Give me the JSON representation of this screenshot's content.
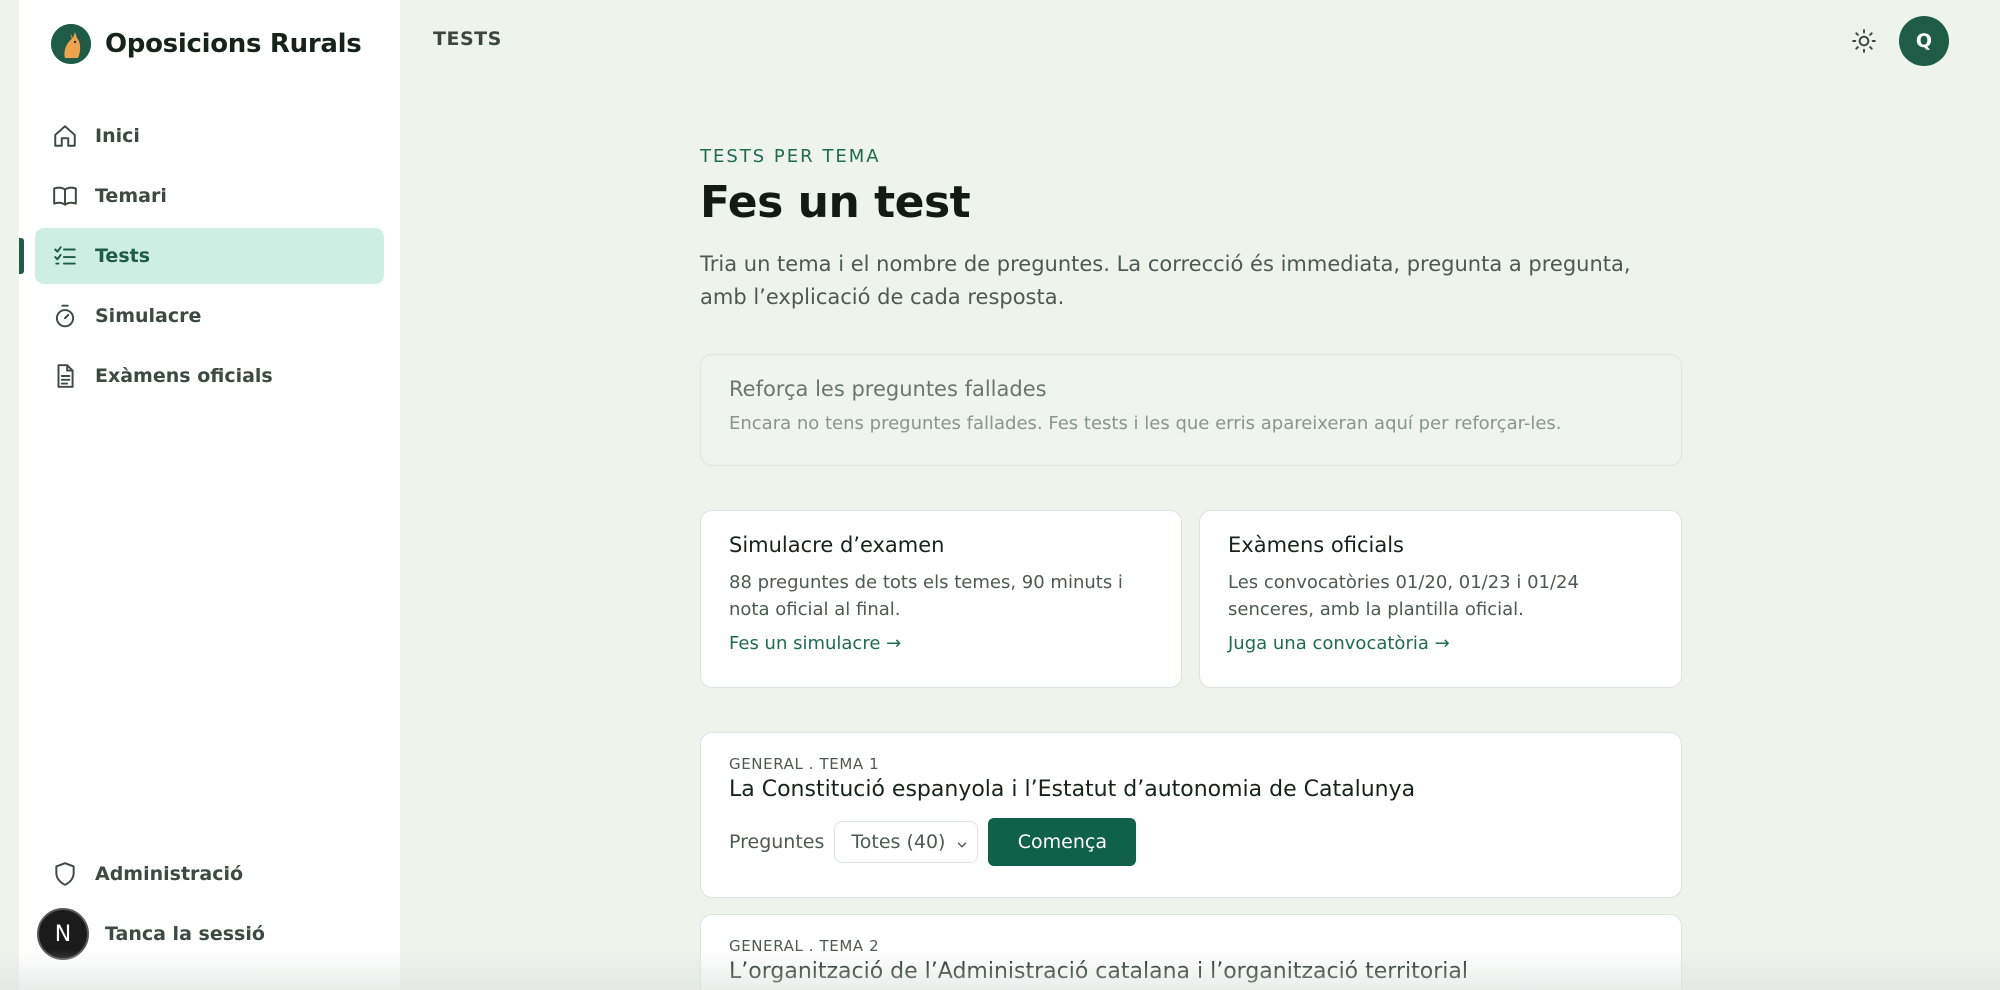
{
  "app": {
    "name": "Oposicions Rurals"
  },
  "sidebar": {
    "items": [
      {
        "label": "Inici",
        "icon": "home-icon"
      },
      {
        "label": "Temari",
        "icon": "book-icon"
      },
      {
        "label": "Tests",
        "icon": "checklist-icon",
        "active": true
      },
      {
        "label": "Simulacre",
        "icon": "timer-icon"
      },
      {
        "label": "Exàmens oficials",
        "icon": "document-icon"
      }
    ],
    "bottom": {
      "admin_label": "Administració",
      "logout_label": "Tanca la sessió",
      "logout_avatar_letter": "N"
    }
  },
  "header": {
    "title": "TESTS",
    "user_initial": "Q"
  },
  "main": {
    "eyebrow": "TESTS PER TEMA",
    "title": "Fes un test",
    "intro": "Tria un tema i el nombre de preguntes. La correcció és immediata, pregunta a pregunta, amb l’explicació de cada resposta.",
    "reinforce": {
      "title": "Reforça les preguntes fallades",
      "desc": "Encara no tens preguntes fallades. Fes tests i les que erris apareixeran aquí per reforçar-les."
    },
    "cards": [
      {
        "title": "Simulacre d’examen",
        "desc": "88 preguntes de tots els temes, 90 minuts i nota oficial al final.",
        "link": "Fes un simulacre →"
      },
      {
        "title": "Exàmens oficials",
        "desc": "Les convocatòries 01/20, 01/23 i 01/24 senceres, amb la plantilla oficial.",
        "link": "Juga una convocatòria →"
      }
    ],
    "topics": [
      {
        "meta": "GENERAL . TEMA 1",
        "title": "La Constitució espanyola i l’Estatut d’autonomia de Catalunya",
        "questions_label": "Preguntes",
        "select_value": "Totes (40)",
        "start_label": "Comença"
      },
      {
        "meta": "GENERAL . TEMA 2",
        "title": "L’organització de l’Administració catalana i l’organització territorial"
      }
    ]
  },
  "colors": {
    "accent": "#1e5c47",
    "active_bg": "#cdeee2",
    "page_bg": "#eef3ec",
    "button": "#0f6249"
  }
}
